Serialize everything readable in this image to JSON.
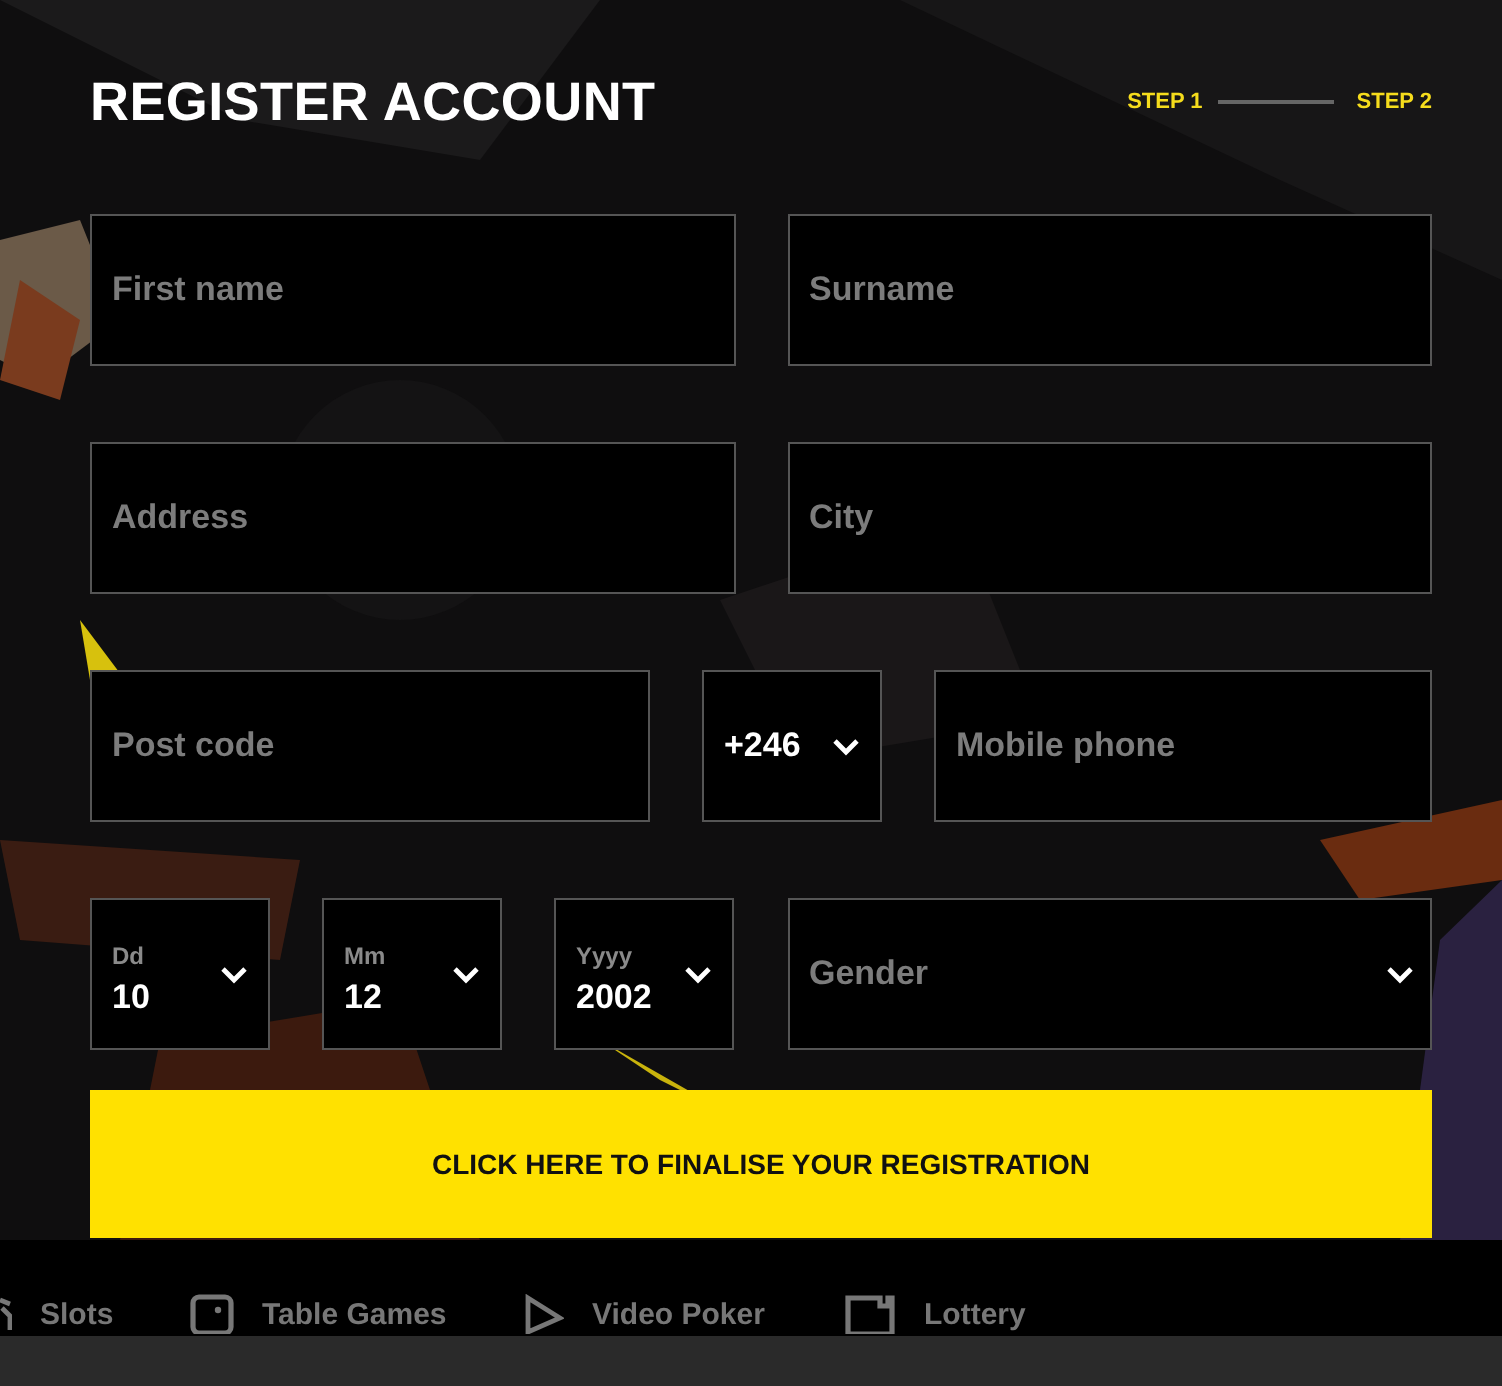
{
  "title": "REGISTER ACCOUNT",
  "steps": [
    "STEP 1",
    "STEP 2"
  ],
  "rows": [
    {
      "left": [
        {
          "kind": "input",
          "placeholder": "First name"
        }
      ],
      "right": [
        {
          "kind": "input",
          "placeholder": "Surname"
        }
      ]
    },
    {
      "left": [
        {
          "kind": "input",
          "placeholder": "Address"
        }
      ],
      "right": [
        {
          "kind": "input",
          "placeholder": "City"
        }
      ]
    },
    {
      "left": [
        {
          "kind": "input",
          "placeholder": "Post code"
        }
      ],
      "right": [
        {
          "kind": "code",
          "value": "+246"
        },
        {
          "kind": "input",
          "placeholder": "Mobile phone"
        }
      ]
    },
    {
      "left": [
        {
          "kind": "date",
          "label": "Dd",
          "value": "10"
        },
        {
          "kind": "date",
          "label": "Mm",
          "value": "12"
        },
        {
          "kind": "date",
          "label": "Yyyy",
          "value": "2002"
        }
      ],
      "right": [
        {
          "kind": "select",
          "placeholder": "Gender"
        }
      ]
    }
  ],
  "submit": "CLICK HERE TO FINALISE YOUR REGISTRATION",
  "nav": [
    "Slots",
    "Table Games",
    "Video Poker",
    "Lottery"
  ]
}
